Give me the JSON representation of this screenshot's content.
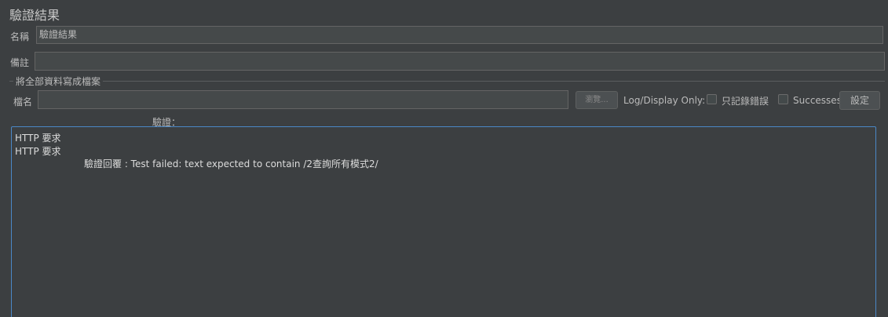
{
  "panel": {
    "title": "驗證結果"
  },
  "name_row": {
    "label": "名稱",
    "value": "驗證結果"
  },
  "comment_row": {
    "label": "備註",
    "value": ""
  },
  "write_all": {
    "group_title": "將全部資料寫成檔案",
    "filename_label": "檔名",
    "filename_value": "",
    "browse_label": "瀏覽...",
    "log_display_label": "Log/Display Only:",
    "errors_only_label": "只記錄錯誤",
    "errors_only_checked": false,
    "successes_label": "Successes",
    "successes_checked": false,
    "configure_label": "設定"
  },
  "assertions": {
    "header": "驗證：",
    "lines": [
      "HTTP 要求",
      "HTTP 要求",
      "驗證回覆 : Test failed: text expected to contain /2查詢所有模式2/"
    ]
  }
}
